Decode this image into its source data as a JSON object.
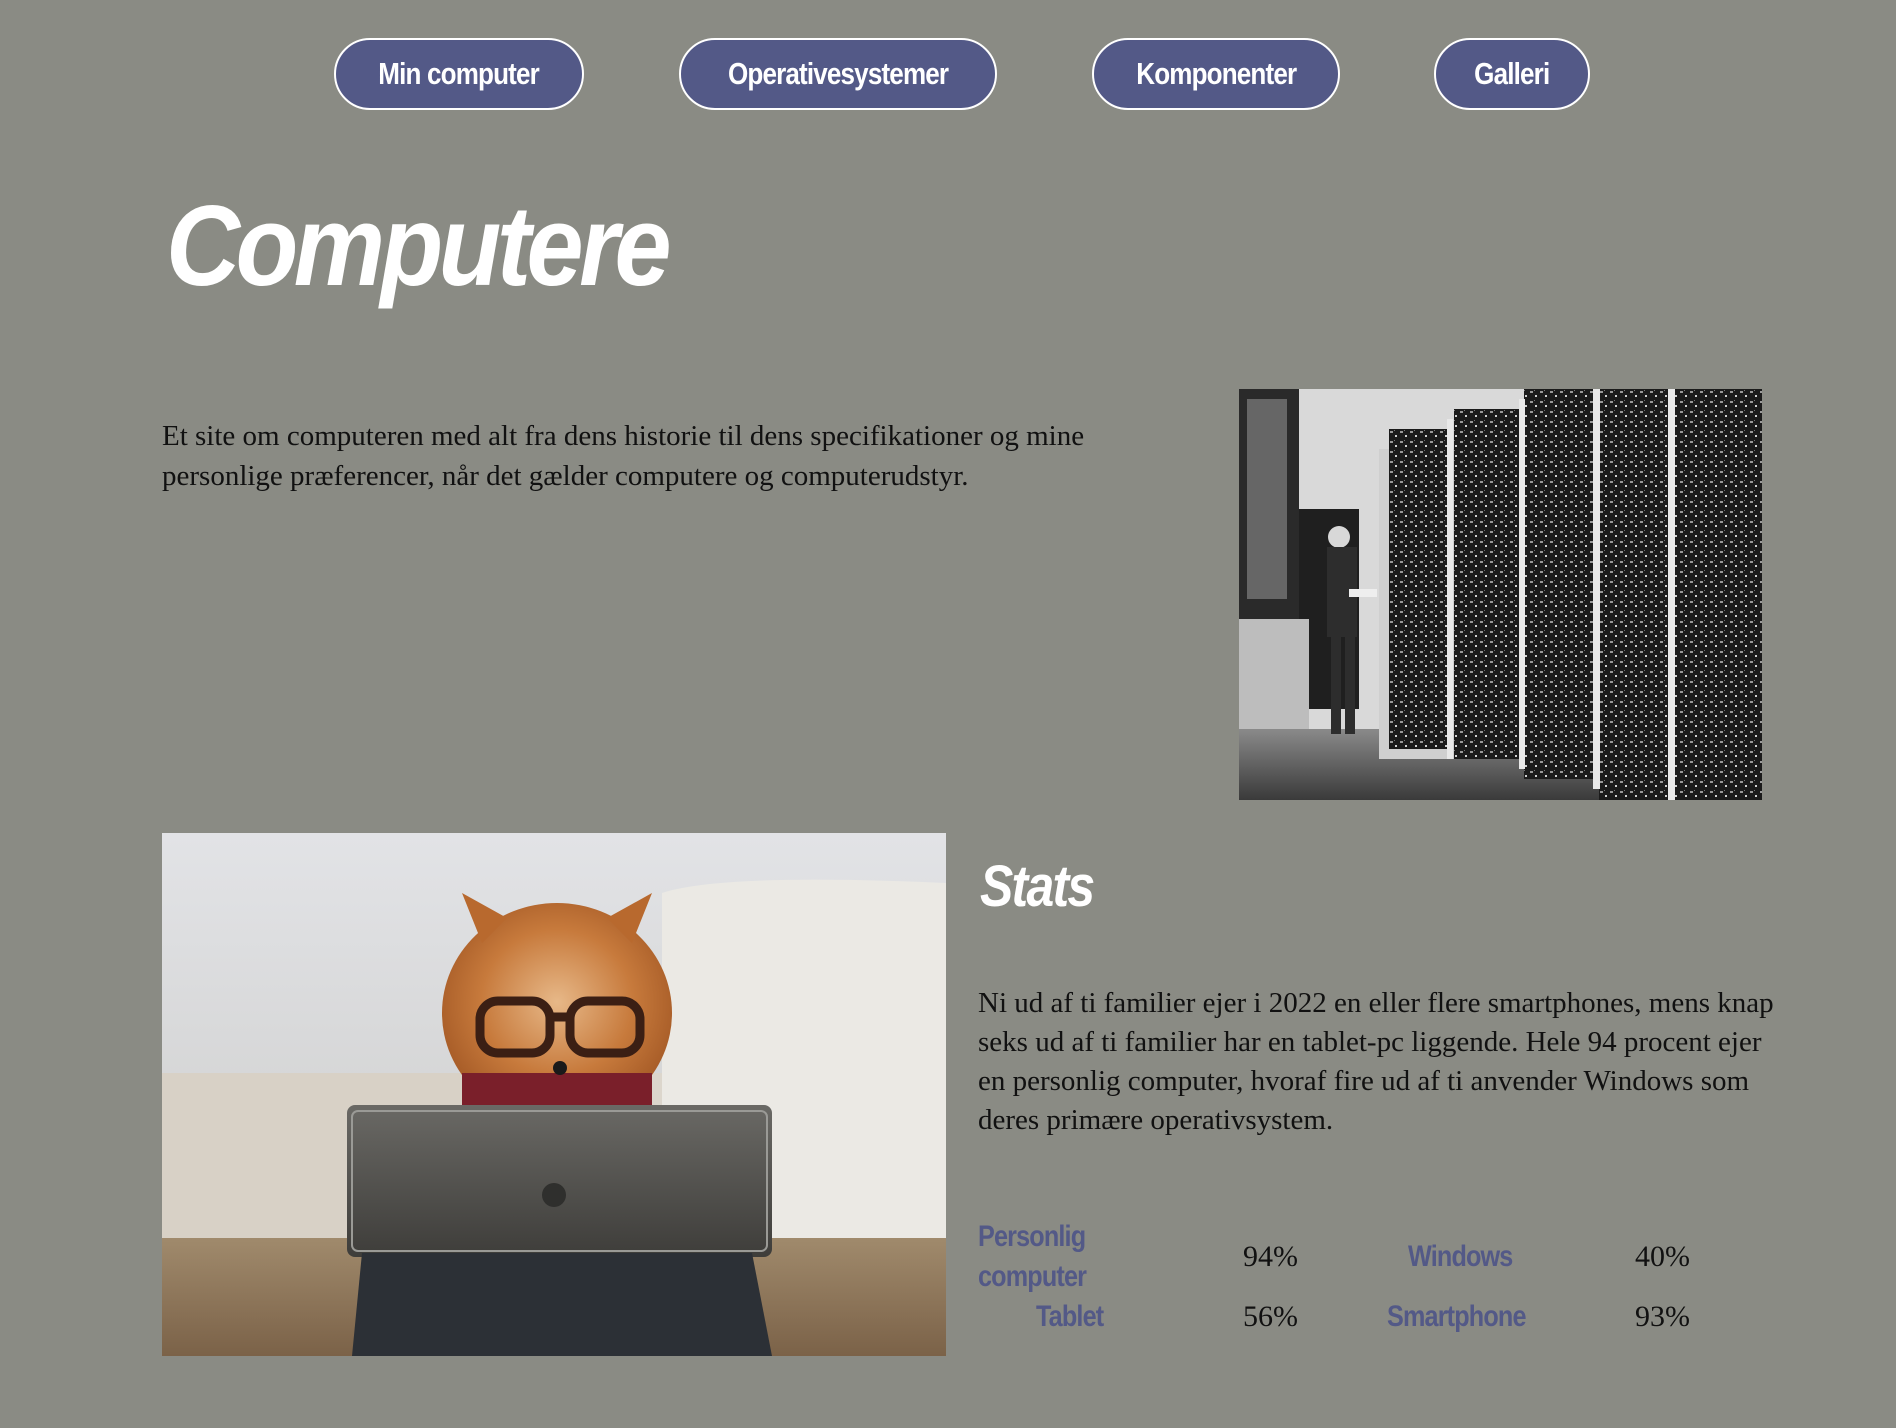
{
  "nav": {
    "items": [
      {
        "label": "Min computer"
      },
      {
        "label": "Operativesystemer"
      },
      {
        "label": "Komponenter"
      },
      {
        "label": "Galleri"
      }
    ]
  },
  "page": {
    "title": "Computere",
    "intro": "Et site om computeren med alt fra dens historie til dens specifikationer og mine personlige præferencer, når det gælder computere og computerudstyr."
  },
  "stats": {
    "title": "Stats",
    "text": "Ni ud af ti familier ejer i 2022 en eller flere smartphones, mens knap seks ud af ti familier har en tablet-pc liggende. Hele 94 procent ejer en personlig computer, hvoraf fire ud af ti anvender Windows som deres primære operativsystem.",
    "rows": [
      {
        "label_line1": "Personlig",
        "label_line2": "computer",
        "value": "94%",
        "label2": "Windows",
        "value2": "40%"
      },
      {
        "label": "Tablet",
        "value": "56%",
        "label2": "Smartphone",
        "value2": "93%"
      }
    ]
  },
  "colors": {
    "background": "#8a8b84",
    "accent": "#535987",
    "heading": "#ffffff"
  }
}
